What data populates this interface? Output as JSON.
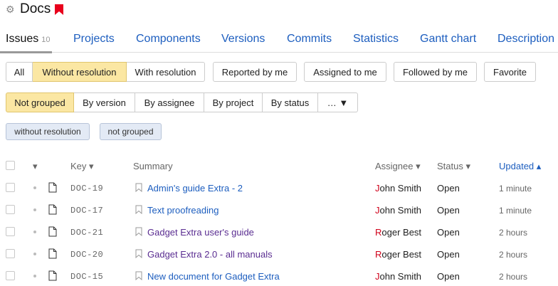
{
  "header": {
    "title": "Docs",
    "gear_icon": "gear-icon",
    "bookmark_icon": "bookmark-icon",
    "bookmark_color": "#e8001c"
  },
  "tabs": [
    {
      "label": "Issues",
      "count": "10"
    },
    {
      "label": "Projects"
    },
    {
      "label": "Components"
    },
    {
      "label": "Versions"
    },
    {
      "label": "Commits"
    },
    {
      "label": "Statistics"
    },
    {
      "label": "Gantt chart"
    },
    {
      "label": "Description"
    }
  ],
  "resolution_filter": {
    "all": "All",
    "without": "Without resolution",
    "with": "With resolution",
    "selected": "Without resolution"
  },
  "user_filters": {
    "reported": "Reported by me",
    "assigned": "Assigned to me",
    "followed": "Followed by me",
    "favorite": "Favorite"
  },
  "grouping": {
    "not_grouped": "Not grouped",
    "by_version": "By version",
    "by_assignee": "By assignee",
    "by_project": "By project",
    "by_status": "By status",
    "more": "… ▼",
    "selected": "Not grouped"
  },
  "active_chips": [
    "without resolution",
    "not grouped"
  ],
  "table": {
    "columns": {
      "select": "▾",
      "key": "Key ▾",
      "summary": "Summary",
      "assignee": "Assignee ▾",
      "status": "Status ▾",
      "updated": "Updated ▴"
    },
    "rows": [
      {
        "key": "DOC-19",
        "summary": "Admin's guide Extra - 2",
        "assignee_initial": "J",
        "assignee_rest": "ohn Smith",
        "status": "Open",
        "updated": "1 minute"
      },
      {
        "key": "DOC-17",
        "summary": "Text proofreading",
        "assignee_initial": "J",
        "assignee_rest": "ohn Smith",
        "status": "Open",
        "updated": "1 minute"
      },
      {
        "key": "DOC-21",
        "summary": "Gadget Extra user's guide",
        "assignee_initial": "R",
        "assignee_rest": "oger Best",
        "status": "Open",
        "updated": "2 hours"
      },
      {
        "key": "DOC-20",
        "summary": "Gadget Extra 2.0 - all manuals",
        "assignee_initial": "R",
        "assignee_rest": "oger Best",
        "status": "Open",
        "updated": "2 hours"
      },
      {
        "key": "DOC-15",
        "summary": "New document for Gadget Extra",
        "assignee_initial": "J",
        "assignee_rest": "ohn Smith",
        "status": "Open",
        "updated": "2 hours"
      }
    ]
  }
}
